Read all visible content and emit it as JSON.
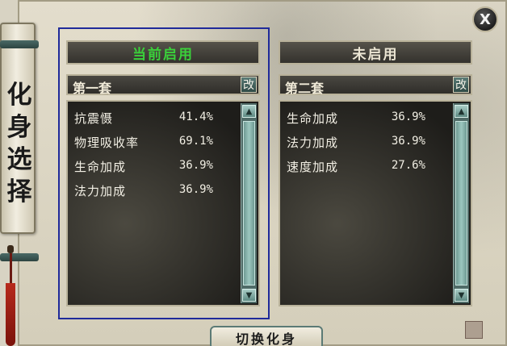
{
  "window": {
    "banner_title": [
      "化",
      "身",
      "选",
      "择"
    ],
    "close_label": "X"
  },
  "panels": [
    {
      "header": "当前启用",
      "set_name": "第一套",
      "edit_label": "改",
      "stats": [
        {
          "label": "抗震慑",
          "value": "41.4%"
        },
        {
          "label": "物理吸收率",
          "value": "69.1%"
        },
        {
          "label": "生命加成",
          "value": "36.9%"
        },
        {
          "label": "法力加成",
          "value": "36.9%"
        }
      ]
    },
    {
      "header": "未启用",
      "set_name": "第二套",
      "edit_label": "改",
      "stats": [
        {
          "label": "生命加成",
          "value": "36.9%"
        },
        {
          "label": "法力加成",
          "value": "36.9%"
        },
        {
          "label": "速度加成",
          "value": "27.6%"
        }
      ]
    }
  ],
  "footer": {
    "switch_label": "切换化身"
  },
  "colors": {
    "active_header": "#3ad13a",
    "inactive_header": "#ece6d4",
    "selection_outline": "#1f2a9a"
  },
  "icons": {
    "scroll_up": "triangle-up-icon",
    "scroll_down": "triangle-down-icon",
    "close": "close-icon"
  }
}
